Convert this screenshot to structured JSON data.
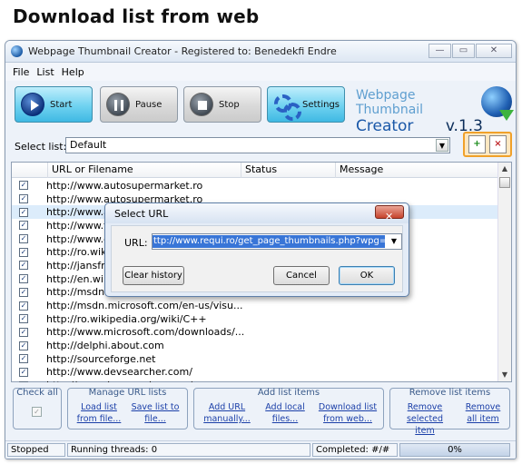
{
  "caption": "Download list from web",
  "window": {
    "title": "Webpage Thumbnail Creator - Registered to: Benedekfi Endre",
    "controls": {
      "minimize": "—",
      "maximize": "▭",
      "close": "✕"
    }
  },
  "menu": {
    "items": [
      "File",
      "List",
      "Help"
    ]
  },
  "toolbar": {
    "start_label": "Start",
    "pause_label": "Pause",
    "stop_label": "Stop",
    "settings_label": "Settings"
  },
  "brand": {
    "line1": "Webpage Thumbnail",
    "name": "Creator",
    "version": "v.1.3"
  },
  "select_list": {
    "label": "Select list:",
    "value": "Default"
  },
  "table": {
    "columns": [
      "URL or Filename",
      "Status",
      "Message"
    ],
    "rows": [
      {
        "checked": true,
        "url": "http://www.autosupermarket.ro"
      },
      {
        "checked": true,
        "url": "http://www.autosupermarket.ro"
      },
      {
        "checked": true,
        "url": "http://www.aut"
      },
      {
        "checked": true,
        "url": "http://www.to"
      },
      {
        "checked": true,
        "url": "http://www.de"
      },
      {
        "checked": true,
        "url": "http://ro.wikip"
      },
      {
        "checked": true,
        "url": "http://jansfre"
      },
      {
        "checked": true,
        "url": "http://en.wiki"
      },
      {
        "checked": true,
        "url": "http://msdn.m"
      },
      {
        "checked": true,
        "url": "http://msdn.microsoft.com/en-us/visu..."
      },
      {
        "checked": true,
        "url": "http://ro.wikipedia.org/wiki/C++"
      },
      {
        "checked": true,
        "url": "http://www.microsoft.com/downloads/..."
      },
      {
        "checked": true,
        "url": "http://delphi.about.com"
      },
      {
        "checked": true,
        "url": "http://sourceforge.net"
      },
      {
        "checked": true,
        "url": "http://www.devsearcher.com/"
      },
      {
        "checked": true,
        "url": "http://www.devsearcher.com/"
      }
    ]
  },
  "dialog": {
    "title": "Select URL",
    "url_label": "URL:",
    "url_value": "ttp://www.requi.ro/get_page_thumbnails.php?wpg=ok&a=list",
    "clear_history": "Clear history",
    "cancel": "Cancel",
    "ok": "OK"
  },
  "bottom": {
    "check_all": {
      "title": "Check all"
    },
    "manage": {
      "title": "Manage URL lists",
      "load_1": "Load list",
      "load_2": "from file...",
      "save_1": "Save list to",
      "save_2": "file..."
    },
    "add": {
      "title": "Add list items",
      "url_1": "Add URL",
      "url_2": "manually...",
      "local_1": "Add local",
      "local_2": "files...",
      "dl_1": "Download list",
      "dl_2": "from web..."
    },
    "remove": {
      "title": "Remove list items",
      "sel_1": "Remove",
      "sel_2": "selected item",
      "all_1": "Remove",
      "all_2": "all item"
    }
  },
  "status": {
    "state": "Stopped",
    "threads": "Running threads: 0",
    "completed": "Completed: #/#",
    "progress_text": "0%",
    "progress_value": 0
  }
}
